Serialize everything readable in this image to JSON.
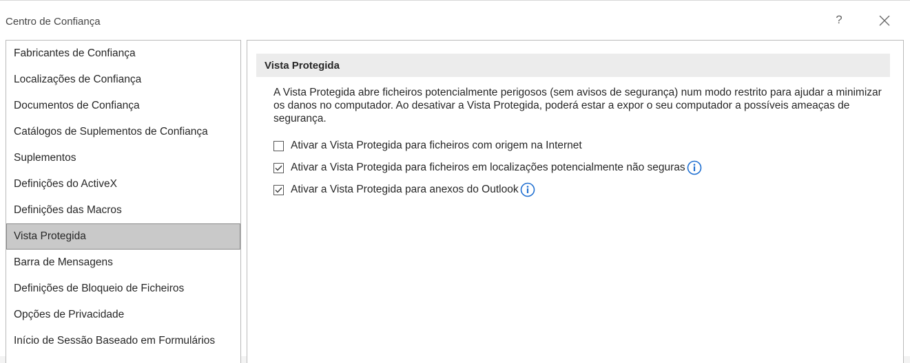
{
  "window": {
    "title": "Centro de Confiança",
    "help_label": "?",
    "close_icon": "close-icon"
  },
  "sidebar": {
    "items": [
      {
        "label": "Fabricantes de Confiança",
        "selected": false
      },
      {
        "label": "Localizações de Confiança",
        "selected": false
      },
      {
        "label": "Documentos de Confiança",
        "selected": false
      },
      {
        "label": "Catálogos de Suplementos de Confiança",
        "selected": false
      },
      {
        "label": "Suplementos",
        "selected": false
      },
      {
        "label": "Definições do ActiveX",
        "selected": false
      },
      {
        "label": "Definições das Macros",
        "selected": false
      },
      {
        "label": "Vista Protegida",
        "selected": true
      },
      {
        "label": "Barra de Mensagens",
        "selected": false
      },
      {
        "label": "Definições de Bloqueio de Ficheiros",
        "selected": false
      },
      {
        "label": "Opções de Privacidade",
        "selected": false
      },
      {
        "label": "Início de Sessão Baseado em Formulários",
        "selected": false
      }
    ]
  },
  "main": {
    "section_title": "Vista Protegida",
    "description": "A Vista Protegida abre ficheiros potencialmente perigosos (sem avisos de segurança) num modo restrito para ajudar a minimizar os danos no computador. Ao desativar a Vista Protegida, poderá estar a expor o seu computador a possíveis ameaças de segurança.",
    "options": [
      {
        "label": "Ativar a Vista Protegida para ficheiros com origem na Internet",
        "checked": false,
        "info": false
      },
      {
        "label": "Ativar a Vista Protegida para ficheiros em localizações potencialmente não seguras",
        "checked": true,
        "info": true
      },
      {
        "label": "Ativar a Vista Protegida para anexos do Outlook",
        "checked": true,
        "info": true
      }
    ]
  },
  "colors": {
    "selected_bg": "#c9c9c9",
    "header_bg": "#ececec",
    "info_blue": "#1f6fd1"
  }
}
